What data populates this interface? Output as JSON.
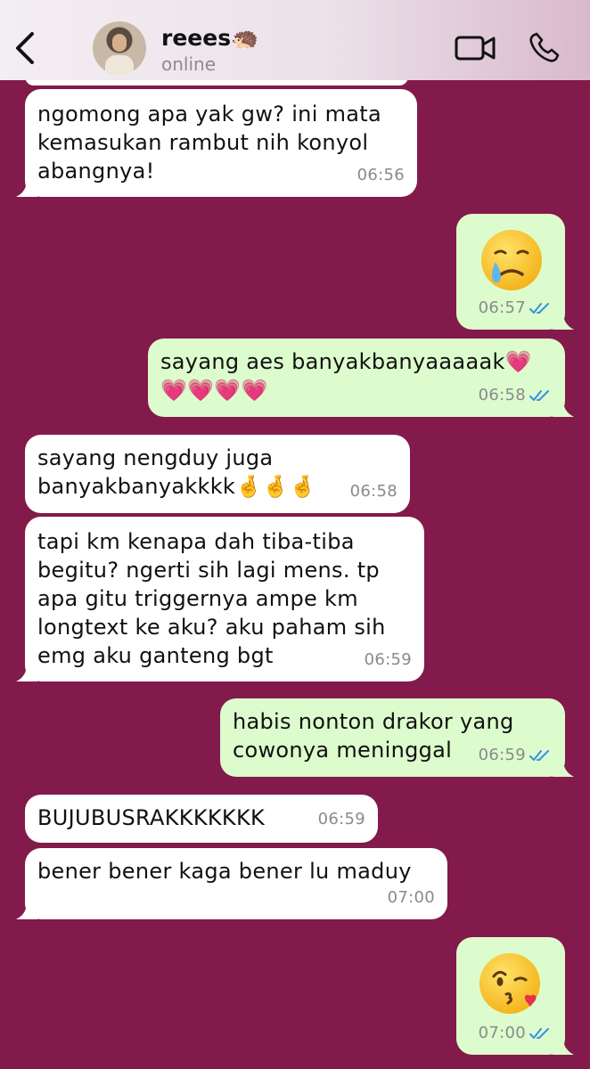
{
  "header": {
    "contact_name": "reees🦔",
    "status": "online",
    "back_icon": "chevron-left-icon",
    "video_icon": "video-call-icon",
    "phone_icon": "phone-call-icon"
  },
  "messages": [
    {
      "dir": "in",
      "text": "ngomong apa yak gw? ini mata\nkemasukan rambut nih konyol\nabangnya!",
      "time": "06:56"
    },
    {
      "dir": "out",
      "emoji": "face-holding-back-tears",
      "time": "06:57"
    },
    {
      "dir": "out",
      "text": "sayang aes banyakbanyaaaaak💗\n💗💗💗💗",
      "time": "06:58"
    },
    {
      "dir": "in",
      "text": "sayang nengduy juga\nbanyakbanyakkkk🤞🤞🤞",
      "time": "06:58"
    },
    {
      "dir": "in",
      "text": "tapi km kenapa dah tiba-tiba\nbegitu? ngerti sih lagi mens. tp\napa gitu triggernya ampe km\nlongtext ke aku? aku paham sih\nemg aku ganteng bgt",
      "time": "06:59"
    },
    {
      "dir": "out",
      "text": "habis nonton drakor yang\ncowonya meninggal",
      "time": "06:59"
    },
    {
      "dir": "in",
      "text": "BUJUBUSRAKKKKKKK",
      "time": "06:59"
    },
    {
      "dir": "in",
      "text": "bener bener kaga bener lu maduy",
      "time": "07:00"
    },
    {
      "dir": "out",
      "emoji": "face-blowing-kiss",
      "time": "07:00"
    }
  ],
  "colors": {
    "background": "#821A4B",
    "incoming_bubble": "#ffffff",
    "outgoing_bubble": "#dcfccd",
    "read_ticks": "#3b8fe0"
  }
}
